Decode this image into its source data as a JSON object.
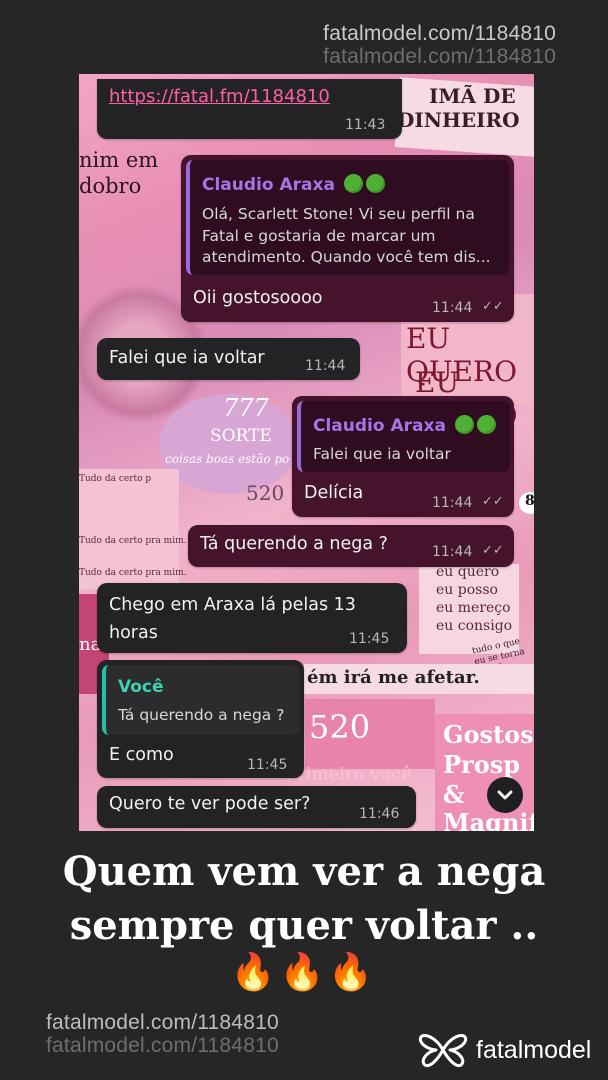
{
  "watermark": {
    "top_line1": "fatalmodel.com/1184810",
    "top_line2": "fatalmodel.com/1184810",
    "bottom_line1": "fatalmodel.com/1184810",
    "bottom_line2": "fatalmodel.com/1184810"
  },
  "background_collage": {
    "t1": "IMÃ DE",
    "t2": "DINHEIRO",
    "t3": "nim em",
    "t4": "dobro",
    "t5": "EU QUERO",
    "t6": "EU POSSO",
    "t7": "777",
    "t8": "SORTE",
    "t9": "coisas boas estão po",
    "t10": "520",
    "t11": "Tudo da certo p",
    "t12": "Tudo da certo pra mim.",
    "t13": "Tudo da certo pra mim.",
    "t14": "eu quero",
    "t15": "eu posso",
    "t16": "eu mereço",
    "t17": "eu consigo",
    "t18": "ém irá me afetar.",
    "t19": "520",
    "t20": "Gostos",
    "t21": "Prosp",
    "t22": "&",
    "t23": "Magnif",
    "t24": "Primeiro você",
    "t25": "nados",
    "t26": "tudo o que eu se torna realid",
    "t27": "8"
  },
  "chat": {
    "msg1": {
      "link": "https://fatal.fm/1184810",
      "time": "11:43"
    },
    "msg2": {
      "quote_name": "Claudio Araxa",
      "quote_text_l1": "Olá, Scarlett Stone! Vi seu perfil na",
      "quote_text_l2": "Fatal e gostaria de marcar um",
      "quote_text_l3": "atendimento. Quando você tem dis...",
      "text": "Oii gostosoooo",
      "time": "11:44"
    },
    "msg3": {
      "text": "Falei que ia voltar",
      "time": "11:44"
    },
    "msg4": {
      "quote_name": "Claudio Araxa",
      "quote_text": "Falei que ia voltar",
      "text": "Delícia",
      "time": "11:44"
    },
    "msg5": {
      "text": "Tá querendo a nega ?",
      "time": "11:44"
    },
    "msg6": {
      "text_l1": "Chego em Araxa lá pelas 13",
      "text_l2": "horas",
      "time": "11:45"
    },
    "msg7": {
      "quote_name": "Você",
      "quote_text": "Tá querendo a nega ?",
      "text": "E como",
      "time": "11:45"
    },
    "msg8": {
      "text": "Quero te ver pode ser?",
      "time": "11:46"
    }
  },
  "caption": {
    "line1": "Quem vem ver a nega",
    "line2": "sempre quer voltar ..",
    "emoji": "🔥🔥🔥"
  },
  "brand": {
    "name": "fatalmodel",
    "icon": "fatalmodel-butterfly-logo"
  },
  "colors": {
    "background": "#262627",
    "bubble_in": "#232325",
    "bubble_out": "#46132d",
    "quote_name_out": "#a873e6",
    "quote_name_in": "#3fd1b1",
    "link": "#ff5fa8"
  }
}
